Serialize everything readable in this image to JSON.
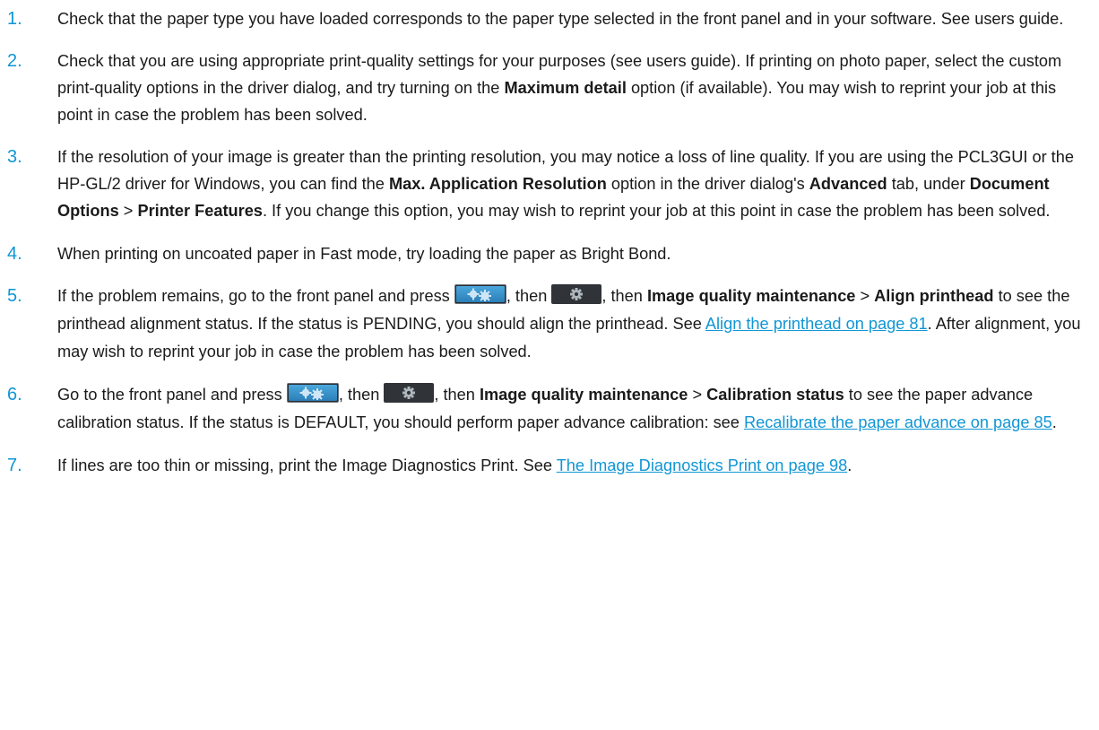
{
  "colors": {
    "accent": "#0e96d6",
    "link": "#1196d4",
    "text": "#1a1a1a"
  },
  "steps": [
    {
      "number": "1.",
      "t1": "Check that the paper type you have loaded corresponds to the paper type selected in the front panel and in your software. See users guide."
    },
    {
      "number": "2.",
      "t1": "Check that you are using appropriate print-quality settings for your purposes (see users guide). If printing on photo paper, select the custom print-quality options in the driver dialog, and try turning on the ",
      "b1": "Maximum detail",
      "t2": " option (if available). You may wish to reprint your job at this point in case the problem has been solved."
    },
    {
      "number": "3.",
      "t1": "If the resolution of your image is greater than the printing resolution, you may notice a loss of line quality. If you are using the PCL3GUI or the HP-GL/2 driver for Windows, you can find the ",
      "b1": "Max. Application Resolution",
      "t2": " option in the driver dialog's ",
      "b2": "Advanced",
      "t3": " tab, under ",
      "b3": "Document Options",
      "t4": " > ",
      "b4": "Printer Features",
      "t5": ". If you change this option, you may wish to reprint your job at this point in case the problem has been solved."
    },
    {
      "number": "4.",
      "t1": "When printing on uncoated paper in Fast mode, try loading the paper as Bright Bond."
    },
    {
      "number": "5.",
      "t1": "If the problem remains, go to the front panel and press ",
      "t2": ", then ",
      "t3": ", then ",
      "b1": "Image quality maintenance",
      "t4": " > ",
      "b2": "Align printhead",
      "t5": " to see the printhead alignment status. If the status is PENDING, you should align the printhead. See ",
      "link": "Align the printhead on page 81",
      "t6": ". After alignment, you may wish to reprint your job in case the problem has been solved."
    },
    {
      "number": "6.",
      "t1": "Go to the front panel and press ",
      "t2": ", then ",
      "t3": ", then ",
      "b1": "Image quality maintenance",
      "t4": " > ",
      "b2": "Calibration status",
      "t5": " to see the paper advance calibration status. If the status is DEFAULT, you should perform paper advance calibration: see ",
      "link": "Recalibrate the paper advance on page 85",
      "t6": "."
    },
    {
      "number": "7.",
      "t1": "If lines are too thin or missing, print the Image Diagnostics Print. See ",
      "link": "The Image Diagnostics Print on page 98",
      "t2": "."
    }
  ],
  "icons": {
    "settings_button": "settings-icon",
    "gear_button": "gear-icon"
  }
}
